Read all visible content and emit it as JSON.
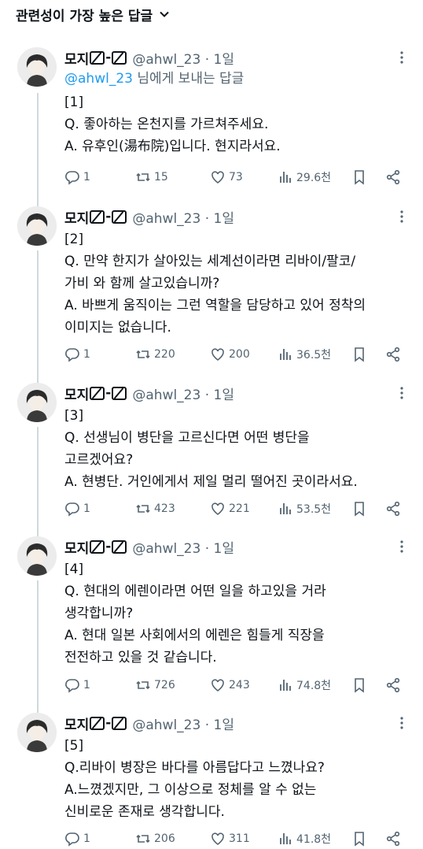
{
  "header": {
    "sort_label": "관련성이 가장 높은 답글"
  },
  "replying_to": {
    "mention": "@ahwl_23",
    "suffix": " 님에게 보내는 답글"
  },
  "tweets": [
    {
      "name": "모지",
      "handle": "@ahwl_23 · 1일",
      "text": "[1]\nQ. 좋아하는 온천지를 가르쳐주세요.\nA. 유후인(湯布院)입니다. 현지라서요.",
      "replies": "1",
      "retweets": "15",
      "likes": "73",
      "views": "29.6천"
    },
    {
      "name": "모지",
      "handle": "@ahwl_23 · 1일",
      "text": "[2]\nQ. 만약 한지가 살아있는 세계선이라면 리바이/팔코/\n가비 와 함께 살고있습니까?\nA. 바쁘게 움직이는 그런 역할을 담당하고 있어 정착의\n이미지는 없습니다.",
      "replies": "1",
      "retweets": "220",
      "likes": "200",
      "views": "36.5천"
    },
    {
      "name": "모지",
      "handle": "@ahwl_23 · 1일",
      "text": "[3]\nQ. 선생님이 병단을 고르신다면 어떤 병단을\n고르겠어요?\nA. 현병단. 거인에게서 제일 멀리 떨어진 곳이라서요.",
      "replies": "1",
      "retweets": "423",
      "likes": "221",
      "views": "53.5천"
    },
    {
      "name": "모지",
      "handle": "@ahwl_23 · 1일",
      "text": "[4]\nQ. 현대의 에렌이라면 어떤 일을 하고있을 거라\n생각합니까?\nA. 현대 일본 사회에서의 에렌은 힘들게 직장을\n전전하고 있을 것 같습니다.",
      "replies": "1",
      "retweets": "726",
      "likes": "243",
      "views": "74.8천"
    },
    {
      "name": "모지",
      "handle": "@ahwl_23 · 1일",
      "text": "[5]\nQ.리바이 병장은 바다를 아름답다고 느꼈나요?\nA.느꼈겠지만, 그 이상으로 정체를 알 수 없는\n신비로운 존재로 생각합니다.",
      "replies": "1",
      "retweets": "206",
      "likes": "311",
      "views": "41.8천"
    }
  ],
  "colors": {
    "text": "#0f1419",
    "muted": "#536471",
    "link": "#1d9bf0",
    "thread": "#cfd9de"
  }
}
